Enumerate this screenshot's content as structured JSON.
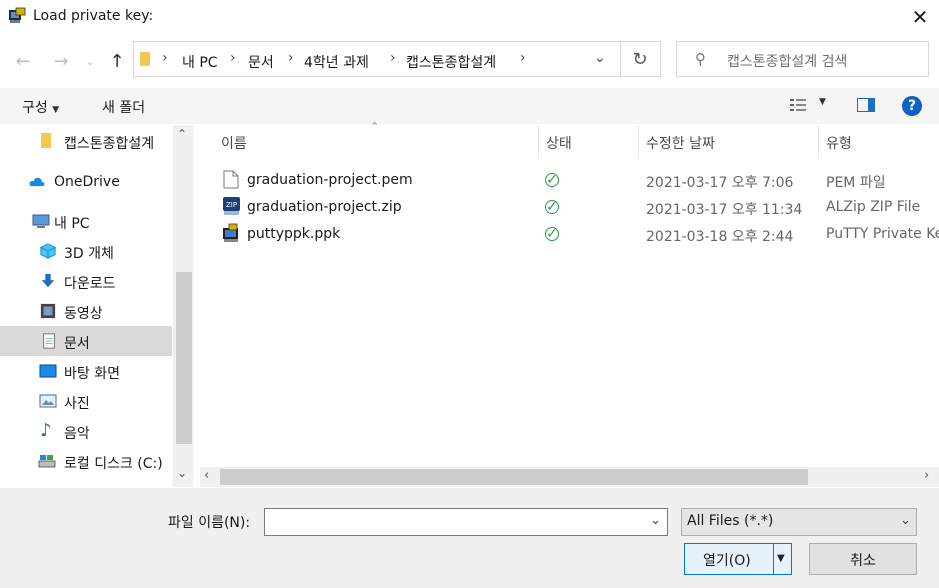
{
  "window": {
    "title": "Load private key:"
  },
  "address": {
    "crumbs": [
      "내 PC",
      "문서",
      "4학년 과제",
      "캡스톤종합설계"
    ]
  },
  "search": {
    "placeholder": "캡스톤종합설계 검색"
  },
  "toolbar": {
    "organize_label": "구성",
    "new_folder_label": "새 폴더"
  },
  "nav": {
    "items": [
      {
        "label": "캡스톤종합설계",
        "icon": "folder-icon"
      },
      {
        "label": "OneDrive",
        "icon": "cloud-icon"
      },
      {
        "label": "내 PC",
        "icon": "pc-icon"
      },
      {
        "label": "3D 개체",
        "icon": "cube-icon"
      },
      {
        "label": "다운로드",
        "icon": "download-icon"
      },
      {
        "label": "동영상",
        "icon": "video-icon"
      },
      {
        "label": "문서",
        "icon": "document-icon",
        "selected": true
      },
      {
        "label": "바탕 화면",
        "icon": "desktop-icon"
      },
      {
        "label": "사진",
        "icon": "pictures-icon"
      },
      {
        "label": "음악",
        "icon": "music-icon"
      },
      {
        "label": "로컬 디스크 (C:)",
        "icon": "disk-icon"
      }
    ]
  },
  "columns": {
    "name": "이름",
    "status": "상태",
    "modified": "수정한 날짜",
    "type": "유형"
  },
  "files": [
    {
      "name": "graduation-project.pem",
      "modified": "2021-03-17 오후 7:06",
      "type": "PEM 파일",
      "icon": "file-icon"
    },
    {
      "name": "graduation-project.zip",
      "modified": "2021-03-17 오후 11:34",
      "type": "ALZip ZIP File",
      "icon": "zip-icon"
    },
    {
      "name": "puttyppk.ppk",
      "modified": "2021-03-18 오후 2:44",
      "type": "PuTTY Private Ke",
      "icon": "putty-icon"
    }
  ],
  "bottom": {
    "filename_label": "파일 이름(N):",
    "filename_value": "",
    "filter_value": "All Files (*.*)",
    "open_label": "열기(O)",
    "cancel_label": "취소"
  }
}
